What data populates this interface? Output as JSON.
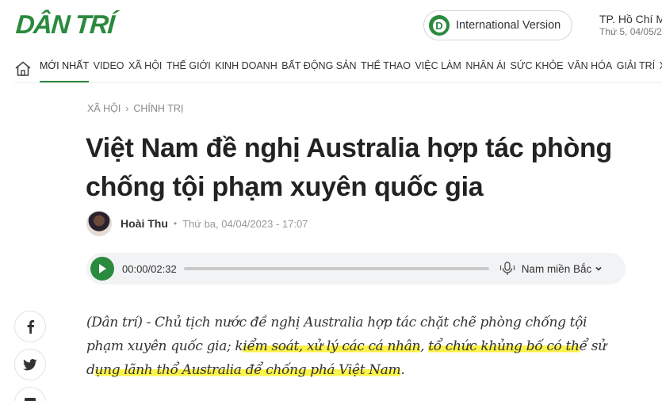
{
  "header": {
    "logo_text": "DÂN TRÍ",
    "intl_badge": "D",
    "intl_label": "International Version",
    "city": "TP. Hồ Chí M",
    "date": "Thứ 5, 04/05/2",
    "brand_color": "#2a8a3e"
  },
  "nav": {
    "items": [
      "MỚI NHẤT",
      "VIDEO",
      "XÃ HỘI",
      "THẾ GIỚI",
      "KINH DOANH",
      "BẤT ĐỘNG SẢN",
      "THỂ THAO",
      "VIỆC LÀM",
      "NHÂN ÁI",
      "SỨC KHỎE",
      "VĂN HÓA",
      "GIẢI TRÍ",
      "XE",
      "++"
    ],
    "active_index": 0
  },
  "breadcrumb": {
    "section": "XÃ HỘI",
    "subsection": "CHÍNH TRỊ"
  },
  "article": {
    "title": "Việt Nam đề nghị Australia hợp tác phòng chống tội phạm xuyên quốc gia",
    "author": "Hoài Thu",
    "published": "Thứ ba, 04/04/2023 - 17:07",
    "lead_parts": [
      "(Dân trí) - Chủ tịch nước đề nghị Australia hợp tác chặt chẽ phòng chống tội phạm xuyên quốc gia; k",
      "iểm soát, xử lý các cá nhân",
      ", ",
      "tổ chức khủng bố có th",
      "ể sử d",
      "ụng lãnh thổ Australia để chống phá Việt Nam",
      "."
    ],
    "highlight_color": "#fbf24a"
  },
  "audio": {
    "time": "00:00/02:32",
    "voice": "Nam miền Bắc",
    "progress": 0
  },
  "share": {
    "icons": [
      "facebook-icon",
      "twitter-icon",
      "comment-icon"
    ]
  }
}
